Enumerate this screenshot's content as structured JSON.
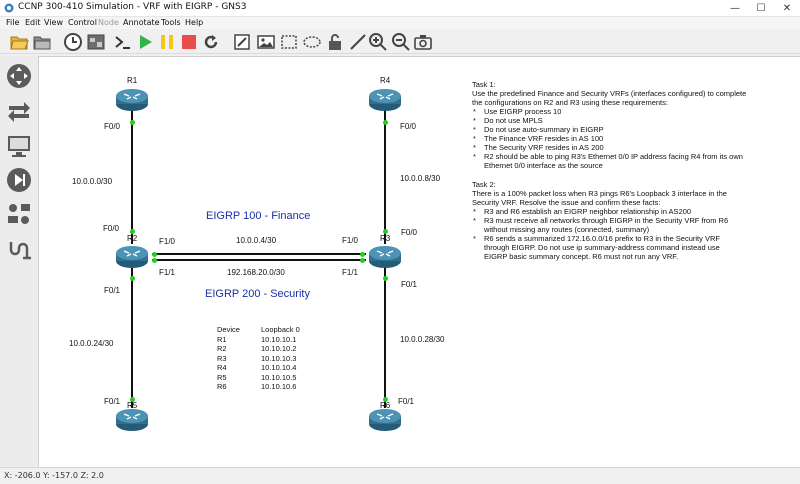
{
  "window": {
    "title": "CCNP 300-410 Simulation - VRF with EIGRP - GNS3",
    "controls": {
      "minimize": "—",
      "maximize": "☐",
      "close": "✕"
    }
  },
  "menu": [
    "File",
    "Edit",
    "View",
    "Control",
    "Node",
    "Annotate",
    "Tools",
    "Help"
  ],
  "toolbar": {
    "icons": [
      "open-folder-icon",
      "folder-icon",
      "clock-icon",
      "snapshot-icon",
      "console-icon",
      "play-icon",
      "pause-icon",
      "stop-icon",
      "reload-icon",
      "edit-note-icon",
      "picture-icon",
      "rectangle-icon",
      "ellipse-icon",
      "unlock-icon",
      "draw-line-icon",
      "zoom-in-icon",
      "zoom-out-icon",
      "screenshot-icon"
    ]
  },
  "dock": {
    "icons": [
      "routers-icon",
      "switches-icon",
      "end-devices-icon",
      "security-devices-icon",
      "all-devices-icon",
      "add-link-icon"
    ]
  },
  "colors": {
    "zone_text": "#1a2fa8",
    "link_up": "#22cc22",
    "router_blue": "#2f6f8f"
  },
  "topology": {
    "routers": {
      "r1": "R1",
      "r2": "R2",
      "r3": "R3",
      "r4": "R4",
      "r5": "R5",
      "r6": "R6"
    },
    "interfaces": {
      "r1_f00": "F0/0",
      "r2_f00": "F0/0",
      "r2_f10": "F1/0",
      "r2_f11": "F1/1",
      "r2_f01": "F0/1",
      "r3_f00": "F0/0",
      "r3_f10": "F1/0",
      "r3_f11": "F1/1",
      "r3_f01": "F0/1",
      "r4_f00": "F0/0",
      "r5_f01": "F0/1",
      "r6_f01": "F0/1"
    },
    "subnets": {
      "r1_r2": "10.0.0.0/30",
      "r4_r3": "10.0.0.8/30",
      "r2_r3_top": "10.0.0.4/30",
      "r2_r3_bottom": "192.168.20.0/30",
      "r2_r5": "10.0.0.24/30",
      "r3_r6": "10.0.0.28/30"
    },
    "zones": {
      "finance": "EIGRP 100 - Finance",
      "security": "EIGRP 200 - Security"
    }
  },
  "loopback_table": {
    "headers": [
      "Device",
      "Loopback 0"
    ],
    "rows": [
      [
        "R1",
        "10.10.10.1"
      ],
      [
        "R2",
        "10.10.10.2"
      ],
      [
        "R3",
        "10.10.10.3"
      ],
      [
        "R4",
        "10.10.10.4"
      ],
      [
        "R5",
        "10.10.10.5"
      ],
      [
        "R6",
        "10.10.10.6"
      ]
    ]
  },
  "task1": {
    "title": "Task 1:",
    "intro": [
      "Use the predefined Finance and Security VRFs (interfaces configured) to complete",
      "the configurations on R2 and R3 using these requirements:"
    ],
    "bullets": [
      [
        "Use EIGRP process 10"
      ],
      [
        "Do not use MPLS"
      ],
      [
        "Do not use auto-summary in EIGRP"
      ],
      [
        "The Finance VRF resides in AS 100"
      ],
      [
        "The Security VRF resides in AS 200"
      ],
      [
        "R2 should be able to ping R3's Ethernet 0/0 IP address facing R4 from its own",
        "Ethernet 0/0 interface as the source"
      ]
    ]
  },
  "task2": {
    "title": "Task 2:",
    "intro": [
      "There is a 100% packet loss when R3 pings R6's Loopback 3 interface in the",
      "Security VRF. Resolve the issue and confirm these facts:"
    ],
    "bullets": [
      [
        "R3 and R6 establish an EIGRP neighbor relationship in AS200"
      ],
      [
        "R3 must receive all networks through EIGRP in the Security VRF from R6",
        "without missing any routes (connected, summary)"
      ],
      [
        "R6 sends a summarized 172.16.0.0/16 prefix to R3 in the Security VRF",
        "through EIGRP. Do not use ip summary-address command instead use",
        "EIGRP basic summary concept. R6 must not run any VRF."
      ]
    ]
  },
  "status": {
    "coords": "X: -206.0 Y: -157.0 Z: 2.0"
  }
}
